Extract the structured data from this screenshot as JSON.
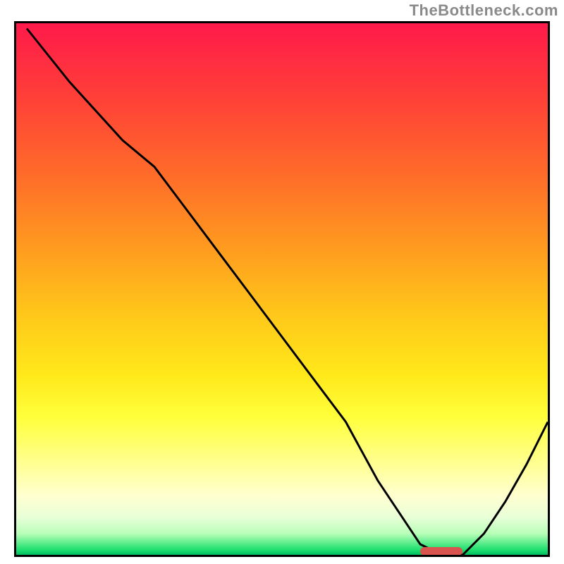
{
  "watermark": "TheBottleneck.com",
  "chart_data": {
    "type": "line",
    "title": "",
    "xlabel": "",
    "ylabel": "",
    "xlim": [
      0,
      100
    ],
    "ylim": [
      0,
      100
    ],
    "grid": false,
    "legend": false,
    "background_gradient": {
      "direction": "vertical",
      "stops": [
        {
          "pos": 0.0,
          "color": "#ff1a4b"
        },
        {
          "pos": 0.12,
          "color": "#ff3a3a"
        },
        {
          "pos": 0.28,
          "color": "#ff6a2a"
        },
        {
          "pos": 0.42,
          "color": "#ff9a1f"
        },
        {
          "pos": 0.55,
          "color": "#ffc81a"
        },
        {
          "pos": 0.66,
          "color": "#ffe81a"
        },
        {
          "pos": 0.74,
          "color": "#ffff3a"
        },
        {
          "pos": 0.82,
          "color": "#ffff8a"
        },
        {
          "pos": 0.89,
          "color": "#ffffd0"
        },
        {
          "pos": 0.93,
          "color": "#e8ffd8"
        },
        {
          "pos": 0.96,
          "color": "#b8ffb8"
        },
        {
          "pos": 0.99,
          "color": "#20e070"
        },
        {
          "pos": 1.0,
          "color": "#00c060"
        }
      ]
    },
    "series": [
      {
        "name": "curve",
        "color": "#000000",
        "stroke_width": 2,
        "x": [
          2,
          10,
          20,
          26,
          32,
          38,
          44,
          50,
          56,
          62,
          68,
          72,
          76,
          80,
          84,
          88,
          92,
          96,
          100
        ],
        "y": [
          99,
          89,
          78,
          73,
          65,
          57,
          49,
          41,
          33,
          25,
          14,
          8,
          2,
          0,
          0,
          4,
          10,
          17,
          25
        ]
      }
    ],
    "optimum_marker": {
      "x_range": [
        76,
        84
      ],
      "y": 0.6,
      "color": "#d9534f",
      "shape": "rounded-bar"
    }
  }
}
